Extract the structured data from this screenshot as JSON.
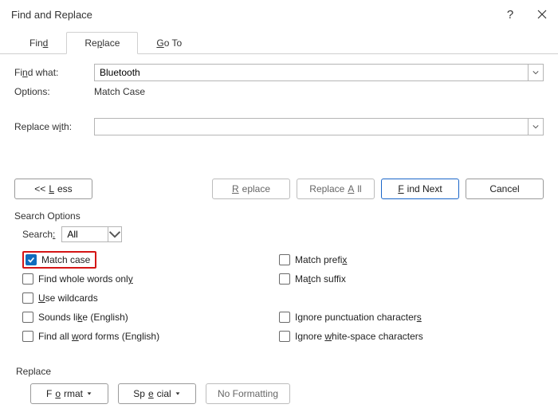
{
  "title": "Find and Replace",
  "tabs": {
    "find": "Find",
    "replace": "Replace",
    "goto": "Go To",
    "find_ul": "d",
    "replace_ul": "p"
  },
  "labels": {
    "find_what": "Find what:",
    "options": "Options:",
    "options_value": "Match Case",
    "replace_with": "Replace with:",
    "find_ul": "n",
    "replace_ul": "i"
  },
  "fields": {
    "find_value": "Bluetooth",
    "replace_value": ""
  },
  "buttons": {
    "less": "<< Less",
    "replace": "Replace",
    "replace_all": "Replace All",
    "find_next": "Find Next",
    "cancel": "Cancel",
    "format": "Format",
    "special": "Special",
    "no_formatting": "No Formatting"
  },
  "section": {
    "search_options": "Search Options",
    "replace": "Replace"
  },
  "search": {
    "label": "Search:",
    "value": "All"
  },
  "checks_left": [
    {
      "label": "Match case",
      "checked": true,
      "ul_before": "",
      "ul": "",
      "ul_after": "Match case",
      "highlighted": true
    },
    {
      "label": "Find whole words only",
      "checked": false,
      "ul_before": "Find whole words onl",
      "ul": "y",
      "ul_after": ""
    },
    {
      "label": "Use wildcards",
      "checked": false,
      "ul_before": "",
      "ul": "U",
      "ul_after": "se wildcards"
    },
    {
      "label": "Sounds like (English)",
      "checked": false,
      "ul_before": "Sounds li",
      "ul": "k",
      "ul_after": "e (English)"
    },
    {
      "label": "Find all word forms (English)",
      "checked": false,
      "ul_before": "Find all ",
      "ul": "w",
      "ul_after": "ord forms (English)"
    }
  ],
  "checks_right": [
    {
      "label": "Match prefix",
      "checked": false,
      "ul_before": "Match prefi",
      "ul": "x",
      "ul_after": ""
    },
    {
      "label": "Match suffix",
      "checked": false,
      "ul_before": "Ma",
      "ul": "t",
      "ul_after": "ch suffix"
    },
    {
      "spacer": true
    },
    {
      "label": "Ignore punctuation characters",
      "checked": false,
      "ul_before": "Ignore punctuation character",
      "ul": "s",
      "ul_after": ""
    },
    {
      "label": "Ignore white-space characters",
      "checked": false,
      "ul_before": "Ignore ",
      "ul": "w",
      "ul_after": "hite-space characters"
    }
  ]
}
